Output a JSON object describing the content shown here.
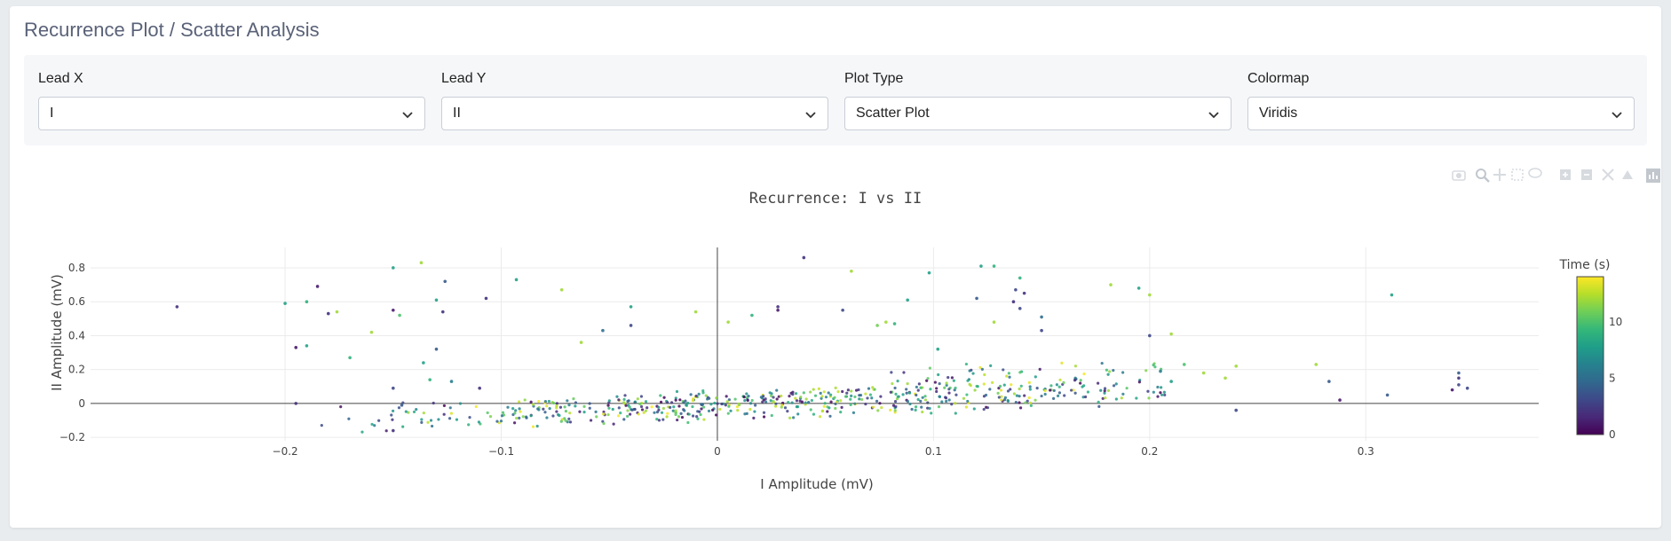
{
  "page_title": "Recurrence Plot / Scatter Analysis",
  "controls": [
    {
      "label": "Lead X",
      "value": "I"
    },
    {
      "label": "Lead Y",
      "value": "II"
    },
    {
      "label": "Plot Type",
      "value": "Scatter Plot"
    },
    {
      "label": "Colormap",
      "value": "Viridis"
    }
  ],
  "modebar_icons": [
    "camera-icon",
    "zoom-icon",
    "pan-icon",
    "box-select-icon",
    "lasso-icon",
    "zoom-in-icon",
    "zoom-out-icon",
    "autoscale-icon",
    "reset-axes-icon",
    "plotly-logo-icon"
  ],
  "chart_data": {
    "type": "scatter",
    "title": "Recurrence: I vs II",
    "xlabel": "I Amplitude (mV)",
    "ylabel": "II Amplitude (mV)",
    "xlim": [
      -0.29,
      0.38
    ],
    "ylim": [
      -0.22,
      0.92
    ],
    "xticks": [
      -0.2,
      -0.1,
      0,
      0.1,
      0.2,
      0.3
    ],
    "xtick_labels": [
      "−0.2",
      "−0.1",
      "0",
      "0.1",
      "0.2",
      "0.3"
    ],
    "yticks": [
      -0.2,
      0,
      0.2,
      0.4,
      0.6,
      0.8
    ],
    "ytick_labels": [
      "−0.2",
      "0",
      "0.2",
      "0.4",
      "0.6",
      "0.8"
    ],
    "grid": true,
    "colorbar": {
      "title": "Time (s)",
      "range": [
        0,
        14
      ],
      "ticks": [
        0,
        5,
        10
      ],
      "tick_labels": [
        "0",
        "5",
        "10"
      ],
      "colormap": "Viridis",
      "stops": [
        "#440154",
        "#482878",
        "#3e4989",
        "#31688e",
        "#26828e",
        "#1f9e89",
        "#35b779",
        "#6ece58",
        "#b5de2b",
        "#fde725"
      ]
    },
    "points": [
      [
        -0.25,
        0.57,
        2
      ],
      [
        -0.2,
        0.59,
        8
      ],
      [
        -0.19,
        0.6,
        9
      ],
      [
        -0.185,
        0.69,
        1
      ],
      [
        -0.18,
        0.53,
        2
      ],
      [
        -0.176,
        0.54,
        12
      ],
      [
        -0.17,
        0.27,
        9
      ],
      [
        -0.19,
        0.34,
        8
      ],
      [
        -0.195,
        0.33,
        1
      ],
      [
        -0.16,
        0.42,
        12
      ],
      [
        -0.15,
        0.8,
        8
      ],
      [
        -0.15,
        0.55,
        1
      ],
      [
        -0.147,
        0.52,
        10
      ],
      [
        -0.137,
        0.83,
        12
      ],
      [
        -0.13,
        0.61,
        8
      ],
      [
        -0.127,
        0.54,
        2
      ],
      [
        -0.126,
        0.72,
        4
      ],
      [
        -0.107,
        0.62,
        2
      ],
      [
        -0.093,
        0.73,
        8
      ],
      [
        -0.072,
        0.67,
        12
      ],
      [
        -0.063,
        0.36,
        12
      ],
      [
        -0.053,
        0.43,
        5
      ],
      [
        -0.04,
        0.57,
        8
      ],
      [
        -0.04,
        0.46,
        3
      ],
      [
        -0.01,
        0.54,
        12
      ],
      [
        0.005,
        0.48,
        12
      ],
      [
        0.016,
        0.52,
        9
      ],
      [
        0.028,
        0.57,
        2
      ],
      [
        0.028,
        0.55,
        1
      ],
      [
        0.04,
        0.86,
        2
      ],
      [
        0.058,
        0.55,
        3
      ],
      [
        0.062,
        0.78,
        12
      ],
      [
        0.074,
        0.46,
        11
      ],
      [
        0.078,
        0.48,
        12
      ],
      [
        0.088,
        0.61,
        8
      ],
      [
        0.082,
        0.47,
        9
      ],
      [
        0.098,
        0.77,
        8
      ],
      [
        0.102,
        0.32,
        8
      ],
      [
        0.12,
        0.62,
        4
      ],
      [
        0.128,
        0.81,
        9
      ],
      [
        0.122,
        0.81,
        8
      ],
      [
        0.128,
        0.48,
        12
      ],
      [
        0.14,
        0.74,
        9
      ],
      [
        0.138,
        0.67,
        3
      ],
      [
        0.142,
        0.65,
        2
      ],
      [
        0.14,
        0.56,
        3
      ],
      [
        0.137,
        0.6,
        2
      ],
      [
        0.15,
        0.51,
        5
      ],
      [
        0.15,
        0.43,
        3
      ],
      [
        0.182,
        0.7,
        12
      ],
      [
        0.195,
        0.68,
        8
      ],
      [
        0.2,
        0.64,
        12
      ],
      [
        0.2,
        0.4,
        3
      ],
      [
        0.21,
        0.41,
        12
      ],
      [
        0.312,
        0.64,
        8
      ],
      [
        -0.13,
        0.32,
        4
      ],
      [
        -0.136,
        0.24,
        8
      ],
      [
        -0.15,
        0.09,
        3
      ],
      [
        -0.15,
        -0.16,
        2
      ],
      [
        -0.146,
        -0.01,
        4
      ],
      [
        -0.195,
        0.0,
        2
      ],
      [
        -0.133,
        0.14,
        9
      ],
      [
        -0.123,
        0.13,
        6
      ],
      [
        -0.11,
        0.09,
        2
      ],
      [
        0.277,
        0.23,
        12
      ],
      [
        0.24,
        0.22,
        12
      ],
      [
        0.235,
        0.15,
        12
      ],
      [
        0.24,
        -0.04,
        3
      ],
      [
        0.283,
        0.13,
        4
      ],
      [
        0.288,
        0.02,
        1
      ],
      [
        0.31,
        0.05,
        4
      ],
      [
        0.34,
        0.08,
        1
      ],
      [
        0.343,
        0.11,
        3
      ],
      [
        0.343,
        0.15,
        2
      ],
      [
        0.343,
        0.18,
        4
      ],
      [
        0.347,
        0.09,
        3
      ],
      [
        0.225,
        0.18,
        12
      ],
      [
        0.216,
        0.23,
        10
      ],
      [
        0.21,
        0.13,
        8
      ],
      [
        0.205,
        0.19,
        6
      ]
    ]
  }
}
